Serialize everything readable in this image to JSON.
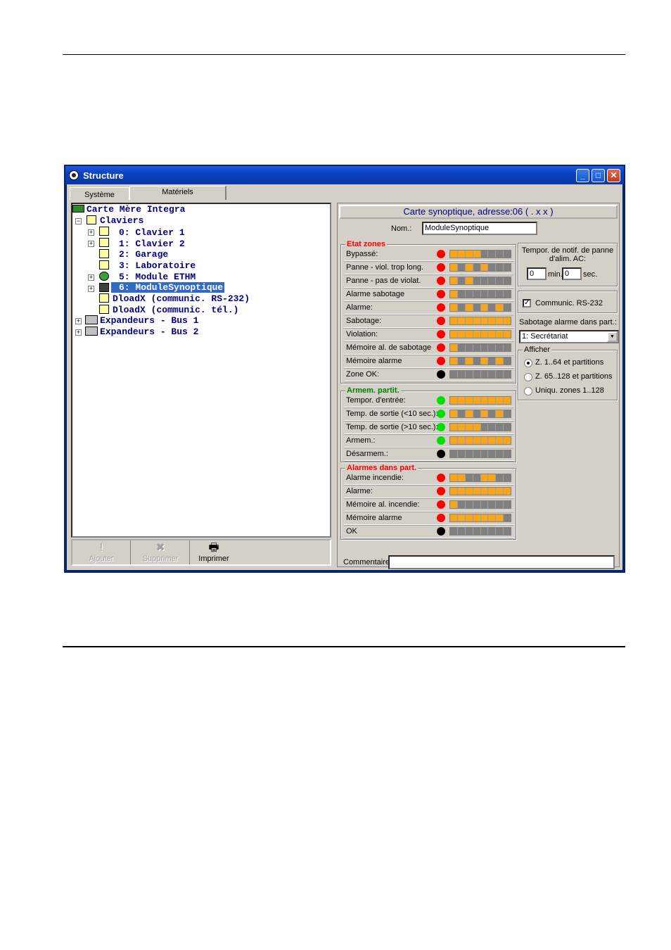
{
  "window": {
    "title": "Structure",
    "controls": {
      "minimize": "_",
      "maximize": "□",
      "close": "✕"
    }
  },
  "tabs": [
    {
      "label": "Système"
    },
    {
      "label": "Matériels"
    }
  ],
  "tree": {
    "root": "Carte Mère Integra",
    "claviers": "Claviers",
    "items": [
      {
        "label": "0: Clavier 1",
        "icon": "keypad-icon"
      },
      {
        "label": "1: Clavier 2",
        "icon": "keypad-icon"
      },
      {
        "label": "2: Garage",
        "icon": "keypad-icon"
      },
      {
        "label": "3: Laboratoire",
        "icon": "keypad-icon"
      },
      {
        "label": "5: Module ETHM",
        "icon": "network-module-icon"
      },
      {
        "label": "6: ModuleSynoptique",
        "icon": "synoptic-icon"
      },
      {
        "label": "DloadX (communic. RS-232)",
        "icon": "dloadx-icon"
      },
      {
        "label": "DloadX (communic. tél.)",
        "icon": "dloadx-icon"
      }
    ],
    "expandeurs": [
      "Expandeurs - Bus 1",
      "Expandeurs - Bus 2"
    ]
  },
  "toolbar": {
    "add": "Ajouter",
    "delete": "Supprimer",
    "print": "Imprimer"
  },
  "panel": {
    "title": "Carte synoptique, adresse:06 ( . x x )",
    "nom_label": "Nom.:",
    "nom_value": "ModuleSynoptique",
    "etat_zones": {
      "title": "Etat zones",
      "rows": [
        {
          "label": "Bypassé:",
          "led": "red",
          "bar": [
            1,
            1,
            1,
            1,
            0,
            0,
            0,
            0
          ]
        },
        {
          "label": "Panne - viol. trop long.",
          "led": "red",
          "bar": [
            1,
            0,
            1,
            0,
            1,
            0,
            0,
            0
          ]
        },
        {
          "label": "Panne - pas de violat.",
          "led": "red",
          "bar": [
            1,
            0,
            1,
            0,
            0,
            0,
            0,
            0
          ]
        },
        {
          "label": "Alarme sabotage",
          "led": "red",
          "bar": [
            1,
            0,
            0,
            0,
            0,
            0,
            0,
            0
          ]
        },
        {
          "label": "Alarme:",
          "led": "red",
          "bar": [
            1,
            0,
            1,
            0,
            1,
            0,
            1,
            0
          ]
        },
        {
          "label": "Sabotage:",
          "led": "red",
          "bar": [
            1,
            1,
            1,
            1,
            1,
            1,
            1,
            1
          ]
        },
        {
          "label": "Violation:",
          "led": "red",
          "bar": [
            1,
            1,
            1,
            1,
            1,
            1,
            1,
            1
          ]
        },
        {
          "label": "Mémoire al. de sabotage",
          "led": "red",
          "bar": [
            1,
            0,
            0,
            0,
            0,
            0,
            0,
            0
          ]
        },
        {
          "label": "Mémoire alarme",
          "led": "red",
          "bar": [
            1,
            0,
            1,
            0,
            1,
            0,
            1,
            0
          ]
        },
        {
          "label": "Zone OK:",
          "led": "black",
          "bar": [
            0,
            0,
            0,
            0,
            0,
            0,
            0,
            0
          ]
        }
      ]
    },
    "armem_partit": {
      "title": "Armem. partit.",
      "rows": [
        {
          "label": "Tempor. d'entrée:",
          "led": "green",
          "bar": [
            1,
            1,
            1,
            1,
            1,
            1,
            1,
            1
          ]
        },
        {
          "label": "Temp. de sortie  (<10 sec.):",
          "led": "green",
          "bar": [
            1,
            0,
            1,
            0,
            1,
            0,
            1,
            0
          ]
        },
        {
          "label": "Temp. de sortie (>10 sec.):",
          "led": "green",
          "bar": [
            1,
            1,
            1,
            1,
            0,
            0,
            0,
            0
          ]
        },
        {
          "label": "Armem.:",
          "led": "green",
          "bar": [
            1,
            1,
            1,
            1,
            1,
            1,
            1,
            1
          ]
        },
        {
          "label": "Désarmem.:",
          "led": "black",
          "bar": [
            0,
            0,
            0,
            0,
            0,
            0,
            0,
            0
          ]
        }
      ]
    },
    "alarmes_part": {
      "title": "Alarmes dans part.",
      "rows": [
        {
          "label": "Alarme incendie:",
          "led": "red",
          "bar": [
            1,
            1,
            0,
            0,
            1,
            1,
            0,
            0
          ]
        },
        {
          "label": "Alarme:",
          "led": "red",
          "bar": [
            1,
            1,
            1,
            1,
            1,
            1,
            1,
            1
          ]
        },
        {
          "label": "Mémoire al. incendie:",
          "led": "red",
          "bar": [
            1,
            0,
            0,
            0,
            0,
            0,
            0,
            0
          ]
        },
        {
          "label": "Mémoire alarme",
          "led": "red",
          "bar": [
            1,
            1,
            1,
            1,
            1,
            1,
            1,
            0
          ]
        },
        {
          "label": "OK",
          "led": "black",
          "bar": [
            0,
            0,
            0,
            0,
            0,
            0,
            0,
            0
          ]
        }
      ]
    },
    "tempor": {
      "label": "Tempor. de notif. de panne d'alim. AC:",
      "min_value": "0",
      "min_label": "min.",
      "sec_value": "0",
      "sec_label": "sec."
    },
    "rs232": {
      "label": "Communic. RS-232",
      "checked": true
    },
    "sabotage": {
      "label": "Sabotage alarme dans part.:",
      "value": "1: Secrétariat"
    },
    "afficher": {
      "title": "Afficher",
      "options": [
        {
          "label": "Z. 1..64 et partitions",
          "selected": true
        },
        {
          "label": "Z. 65..128 et partitions",
          "selected": false
        },
        {
          "label": "Uniqu. zones 1..128",
          "selected": false
        }
      ]
    },
    "commentaire_label": "Commentaire:",
    "commentaire_value": ""
  },
  "colors": {
    "led_red": "#ff0000",
    "led_green": "#00e000",
    "led_black": "#000000",
    "segment_on": "#f7a51c",
    "segment_off": "#808080",
    "tree_text": "#000080",
    "etat_title": "#ff0000",
    "armem_title": "#008000",
    "alarmes_title": "#ff0000"
  }
}
